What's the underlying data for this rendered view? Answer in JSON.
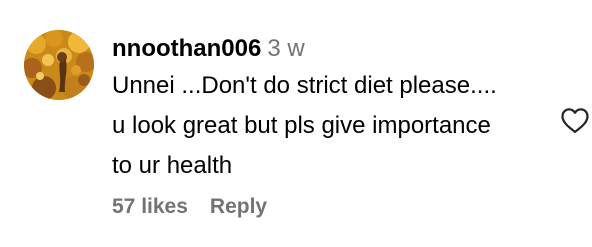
{
  "comment": {
    "username": "nnoothan006",
    "time_ago": "3 w",
    "text": "Unnei ...Don't do strict diet please.... u look great but pls give importance to ur health",
    "likes_label": "57 likes",
    "reply_label": "Reply",
    "avatar_icon": "profile-avatar",
    "like_icon": "heart-outline-icon",
    "colors": {
      "text": "#000000",
      "muted": "#737373",
      "heart_stroke": "#262626"
    }
  }
}
